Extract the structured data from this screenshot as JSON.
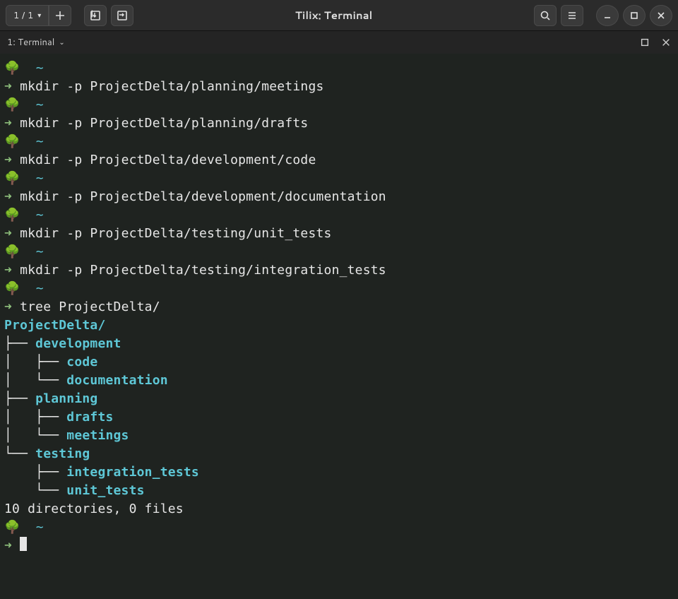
{
  "header": {
    "session_counter": "1 / 1",
    "title": "Tilix: Terminal"
  },
  "tabbar": {
    "label": "1: Terminal"
  },
  "prompt": {
    "tree_emoji": "🌳",
    "tilde": "~",
    "arrow": "➜"
  },
  "commands": [
    "mkdir -p ProjectDelta/planning/meetings",
    "mkdir -p ProjectDelta/planning/drafts",
    "mkdir -p ProjectDelta/development/code",
    "mkdir -p ProjectDelta/development/documentation",
    "mkdir -p ProjectDelta/testing/unit_tests",
    "mkdir -p ProjectDelta/testing/integration_tests",
    "tree ProjectDelta/"
  ],
  "tree": {
    "root": "ProjectDelta/",
    "lines": [
      {
        "prefix": "├── ",
        "name": "development"
      },
      {
        "prefix": "│   ├── ",
        "name": "code"
      },
      {
        "prefix": "│   └── ",
        "name": "documentation"
      },
      {
        "prefix": "├── ",
        "name": "planning"
      },
      {
        "prefix": "│   ├── ",
        "name": "drafts"
      },
      {
        "prefix": "│   └── ",
        "name": "meetings"
      },
      {
        "prefix": "└── ",
        "name": "testing"
      },
      {
        "prefix": "    ├── ",
        "name": "integration_tests"
      },
      {
        "prefix": "    └── ",
        "name": "unit_tests"
      }
    ],
    "summary": "10 directories, 0 files"
  }
}
